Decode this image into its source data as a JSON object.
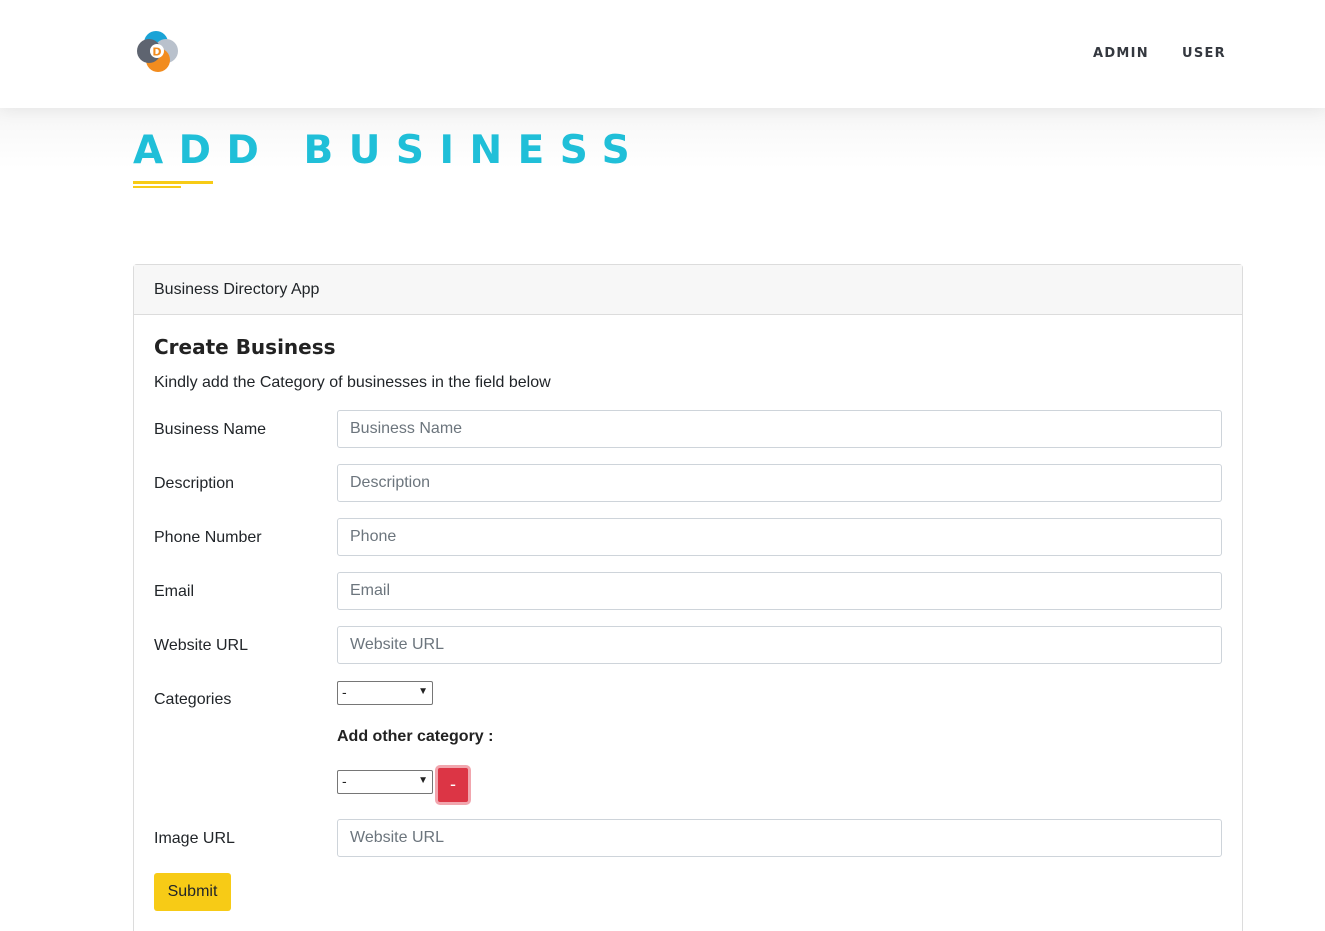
{
  "nav": {
    "logo_icon": "d-circles-logo-icon",
    "links": [
      "ADMIN",
      "USER"
    ]
  },
  "page": {
    "title": "ADD BUSINESS"
  },
  "card": {
    "header": "Business Directory App",
    "title": "Create Business",
    "subtitle": "Kindly add the Category of businesses in the field below"
  },
  "form": {
    "business_name": {
      "label": "Business Name",
      "placeholder": "Business Name",
      "value": ""
    },
    "description": {
      "label": "Description",
      "placeholder": "Description",
      "value": ""
    },
    "phone": {
      "label": "Phone Number",
      "placeholder": "Phone",
      "value": ""
    },
    "email": {
      "label": "Email",
      "placeholder": "Email",
      "value": ""
    },
    "website": {
      "label": "Website URL",
      "placeholder": "Website URL",
      "value": ""
    },
    "categories": {
      "label": "Categories",
      "selected": "-"
    },
    "add_other_label": "Add other category :",
    "other_category": {
      "selected": "-"
    },
    "remove_label": "-",
    "image_url": {
      "label": "Image URL",
      "placeholder": "Website URL",
      "value": ""
    },
    "submit_label": "Submit"
  },
  "colors": {
    "title": "#20bfd8",
    "accent_yellow": "#f7cb16",
    "danger": "#dc3545"
  }
}
